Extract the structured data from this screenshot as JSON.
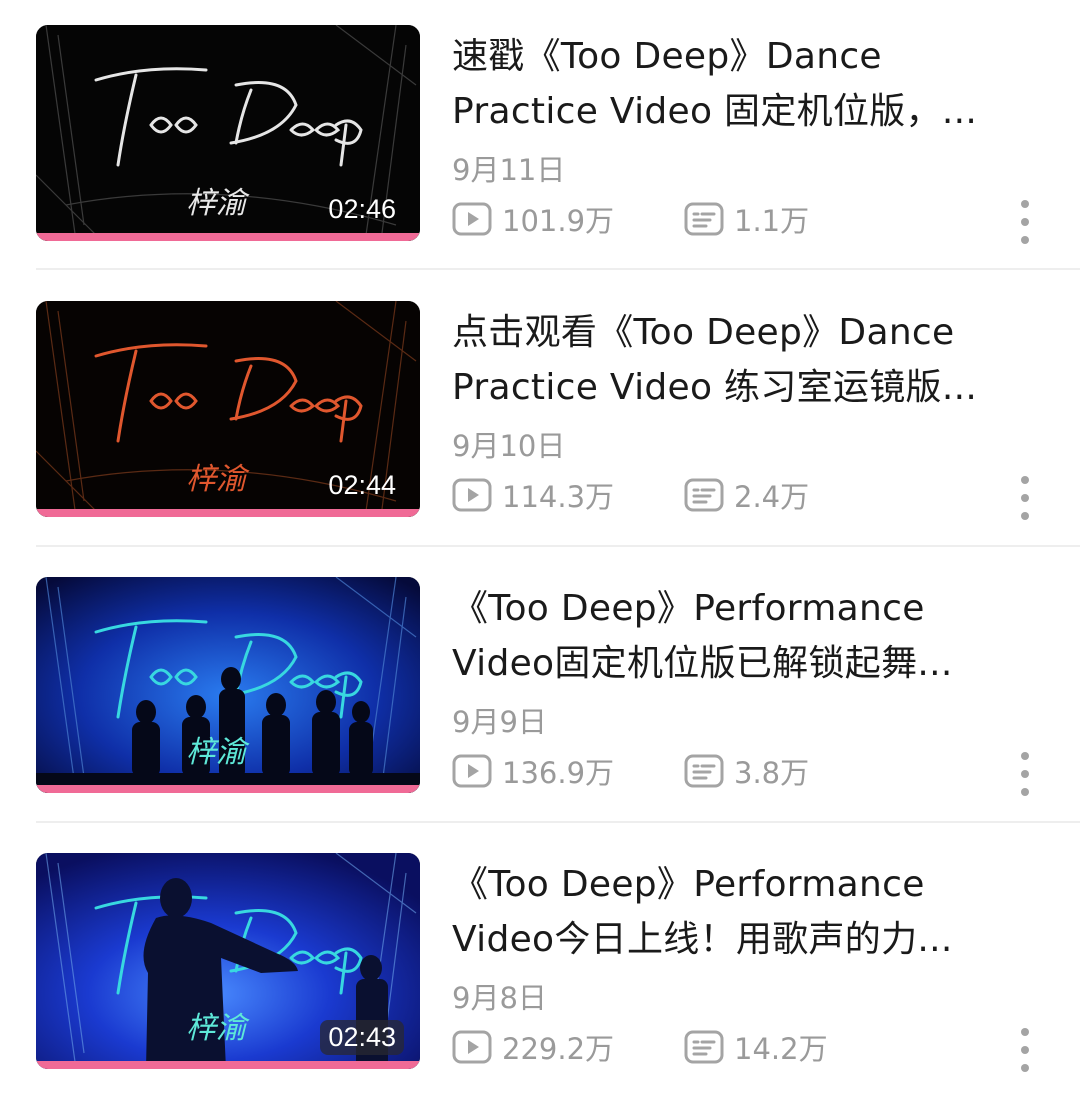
{
  "videos": [
    {
      "title_line1": "速戳《Too Deep》Dance",
      "title_line2": "Practice Video 固定机位版，...",
      "date": "9月11日",
      "plays": "101.9万",
      "comments": "1.1万",
      "duration": "02:46",
      "thumb_script_text": "Too Deep",
      "thumb_name": "梓渝",
      "thumb_style": "white-on-black"
    },
    {
      "title_line1": "点击观看《Too Deep》Dance",
      "title_line2": "Practice Video 练习室运镜版...",
      "date": "9月10日",
      "plays": "114.3万",
      "comments": "2.4万",
      "duration": "02:44",
      "thumb_script_text": "Too Deep",
      "thumb_name": "梓渝",
      "thumb_style": "orange-on-black"
    },
    {
      "title_line1": "《Too Deep》Performance",
      "title_line2": "Video固定机位版已解锁起舞...",
      "date": "9月9日",
      "plays": "136.9万",
      "comments": "3.8万",
      "duration": "",
      "thumb_script_text": "Too Deep",
      "thumb_name": "梓渝",
      "thumb_style": "cyan-on-blue-stage"
    },
    {
      "title_line1": "《Too Deep》Performance",
      "title_line2": "Video今日上线！用歌声的力...",
      "date": "9月8日",
      "plays": "229.2万",
      "comments": "14.2万",
      "duration": "02:43",
      "thumb_script_text": "Too Deep",
      "thumb_name": "梓渝",
      "thumb_style": "cyan-on-blue-silhouette"
    }
  ],
  "icons": {
    "plays": "play-count-icon",
    "comments": "danmaku-icon",
    "more": "more-vertical-icon"
  },
  "colors": {
    "progress": "#f06a96",
    "meta_text": "#9a9a9a",
    "title_text": "#1a1a1a"
  }
}
